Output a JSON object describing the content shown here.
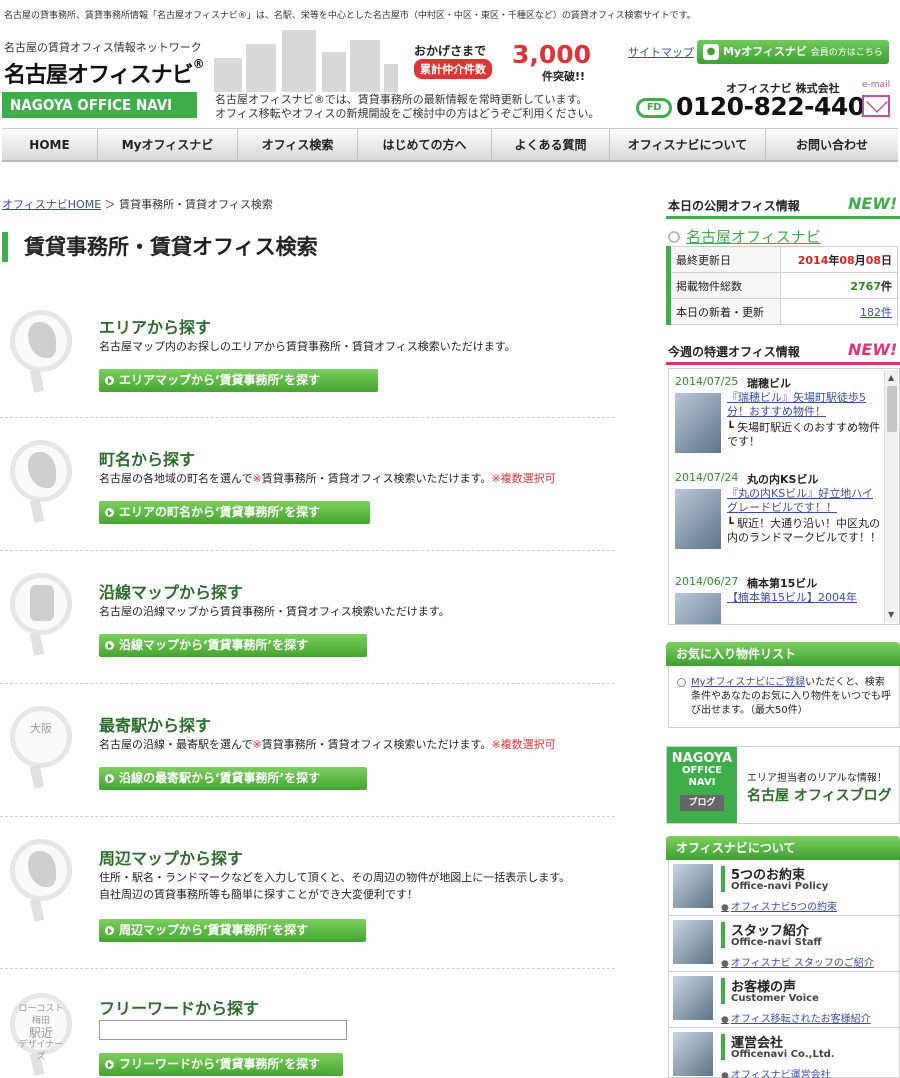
{
  "header": {
    "intro_line": "名古屋の貸事務所、賃貸事務所情報「名古屋オフィスナビ®」は、名駅、栄等を中心とした名古屋市（中村区・中区・東区・千種区など）の賃貸オフィス検索サイトです。",
    "brand_tag": "名古屋の賃貸オフィス情報ネットワーク",
    "brand_name_prefix": "名古屋",
    "brand_name_main": "オフィスナビ",
    "brand_mark": "®",
    "brand_en": "NAGOYA OFFICE NAVI",
    "lead_1": "名古屋オフィスナビ®では、賃貸事務所の最新情報を常時更新しています。",
    "lead_2": "オフィス移転やオフィスの新規開設をご検討中の方はどうぞご利用ください。",
    "promo_a": "おかげさまで",
    "promo_b": "累計仲介件数",
    "promo_num": "3,000",
    "promo_tail": "件突破!!",
    "sitemap": "サイトマップ",
    "my_btn": "Myオフィスナビ",
    "my_btn_sub": "会員の方はこちら",
    "company": "オフィスナビ 株式会社",
    "email_label": "e-mail",
    "freedial_mark": "FD",
    "tel": "0120-822-440"
  },
  "nav": [
    "HOME",
    "Myオフィスナビ",
    "オフィス検索",
    "はじめての方へ",
    "よくある質問",
    "オフィスナビについて",
    "お問い合わせ"
  ],
  "breadcrumb": {
    "home": "オフィスナビHOME",
    "sep": "＞",
    "current": "賃貸事務所・賃貸オフィス検索"
  },
  "page_title": "賃貸事務所・賃貸オフィス検索",
  "sections": [
    {
      "title": "エリアから探す",
      "desc": "名古屋マップ内のお探しのエリアから賃貸事務所・賃貸オフィス検索いただけます。",
      "button": "エリアマップから‘賃貸事務所’を探す"
    },
    {
      "title": "町名から探す",
      "desc": "名古屋の各地域の町名を選んで",
      "note1": "※",
      "desc_b": "賃貸事務所・賃貸オフィス検索いただけます。",
      "note2": "※複数選択可",
      "button": "エリアの町名から‘賃貸事務所’を探す"
    },
    {
      "title": "沿線マップから探す",
      "desc": "名古屋の沿線マップから賃貸事務所・賃貸オフィス検索いただけます。",
      "button": "沿線マップから‘賃貸事務所’を探す"
    },
    {
      "title": "最寄駅から探す",
      "icon_text": "大阪",
      "desc": "名古屋の沿線・最寄駅を選んで",
      "note1": "※",
      "desc_b": "賃貸事務所・賃貸オフィス検索いただけます。",
      "note2": "※複数選択可",
      "button": "沿線の最寄駅から‘賃貸事務所’を探す"
    },
    {
      "title": "周辺マップから探す",
      "desc": "住所・駅名・ランドマークなどを入力して頂くと、その周辺の物件が地図上に一括表示します。",
      "desc2": "自社周辺の賃貸事務所等も簡単に探すことができ大変便利です！",
      "button": "周辺マップから‘賃貸事務所’を探す"
    },
    {
      "title": "フリーワードから探す",
      "icon_text_1": "ローコスト 梅田",
      "icon_text_2": "駅近",
      "icon_text_3": "デザイナーズ",
      "input_value": "",
      "button": "フリーワードから‘賃貸事務所’を探す"
    }
  ],
  "today": {
    "heading": "本日の公開オフィス情報",
    "new": "NEW!",
    "link": "名古屋オフィスナビ",
    "rows": [
      {
        "label": "最終更新日",
        "y": "2014",
        "yu": "年",
        "m": "08",
        "mu": "月",
        "d": "08",
        "du": "日"
      },
      {
        "label": "掲載物件総数",
        "value": "2767",
        "unit": "件"
      },
      {
        "label": "本日の新着・更新",
        "value": "182",
        "unit": "件"
      }
    ]
  },
  "weekly": {
    "heading": "今週の特選オフィス情報",
    "new": "NEW!",
    "items": [
      {
        "date": "2014/07/25",
        "name": "瑞穂ビル",
        "headline": "『瑞穂ビル』矢場町駅徒歩5分！おすすめ物件！",
        "desc": "┗ 矢場町駅近くのおすすめ物件です！"
      },
      {
        "date": "2014/07/24",
        "name": "丸の内KSビル",
        "headline": "『丸の内KSビル』好立地ハイグレードビルです！！",
        "desc": "┗ 駅近！大通り沿い！中区丸の内のランドマークビルです！！"
      },
      {
        "date": "2014/06/27",
        "name": "楠本第15ビル",
        "headline": "【楠本第15ビル】2004年",
        "desc": ""
      }
    ]
  },
  "favorites": {
    "heading": "お気に入り物件リスト",
    "link": "Myオフィスナビにご登録",
    "text": "いただくと、検索条件やあなたのお気に入り物件をいつでも呼び出せます。（最大50件）"
  },
  "blog": {
    "l1": "NAGOYA",
    "l2": "OFFICE NAVI",
    "l3": "ブログ",
    "catch": "エリア担当者のリアルな情報！",
    "title": "名古屋 オフィスブログ"
  },
  "about": {
    "heading": "オフィスナビについて",
    "items": [
      {
        "t1": "5つのお約束",
        "t2": "Office-navi Policy",
        "link": "オフィスナビ5つの約束"
      },
      {
        "t1": "スタッフ紹介",
        "t2": "Office-navi Staff",
        "link": "オフィスナビ スタッフのご紹介"
      },
      {
        "t1": "お客様の声",
        "t2": "Customer Voice",
        "link": "オフィス移転されたお客様紹介"
      },
      {
        "t1": "運営会社",
        "t2": "Officenavi Co.,Ltd.",
        "link": "オフィスナビ運営会社"
      }
    ]
  },
  "colors": {
    "accent": "#3dae49",
    "heading_green": "#2d6b2d",
    "link": "#3b4ea5",
    "red": "#e03333",
    "pink": "#c04fa0"
  }
}
